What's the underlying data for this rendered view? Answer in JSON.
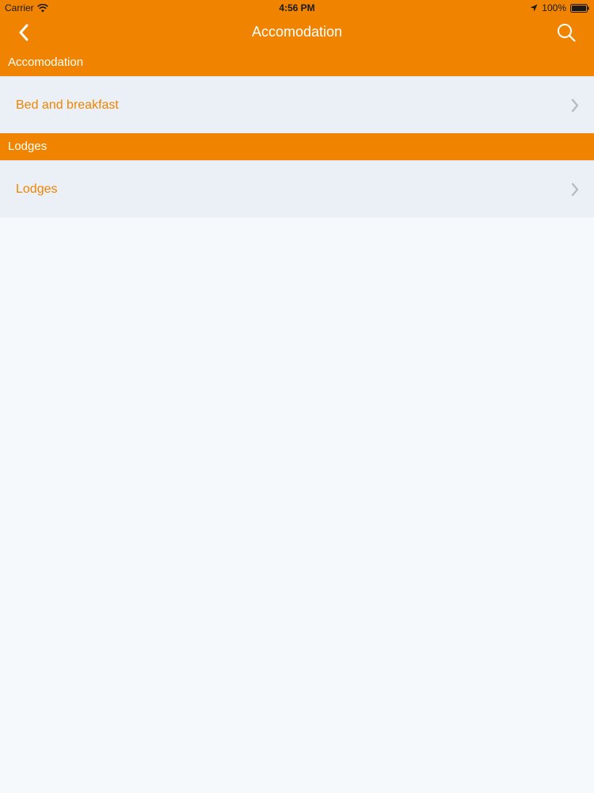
{
  "status_bar": {
    "carrier": "Carrier",
    "time": "4:56 PM",
    "battery": "100%",
    "icons": [
      "wifi-icon",
      "location-icon",
      "battery-icon"
    ]
  },
  "nav": {
    "title": "Accomodation",
    "back_icon": "chevron-left-icon",
    "search_icon": "search-icon"
  },
  "sections": [
    {
      "header": "Accomodation",
      "items": [
        {
          "label": "Bed and breakfast",
          "icon": "chevron-right-icon"
        }
      ]
    },
    {
      "header": "Lodges",
      "items": [
        {
          "label": "Lodges",
          "icon": "chevron-right-icon"
        }
      ]
    }
  ],
  "colors": {
    "accent": "#f08400",
    "row_background": "#eaf0f5",
    "page_background": "#f5f9fc",
    "chevron": "#b8bcc2"
  }
}
